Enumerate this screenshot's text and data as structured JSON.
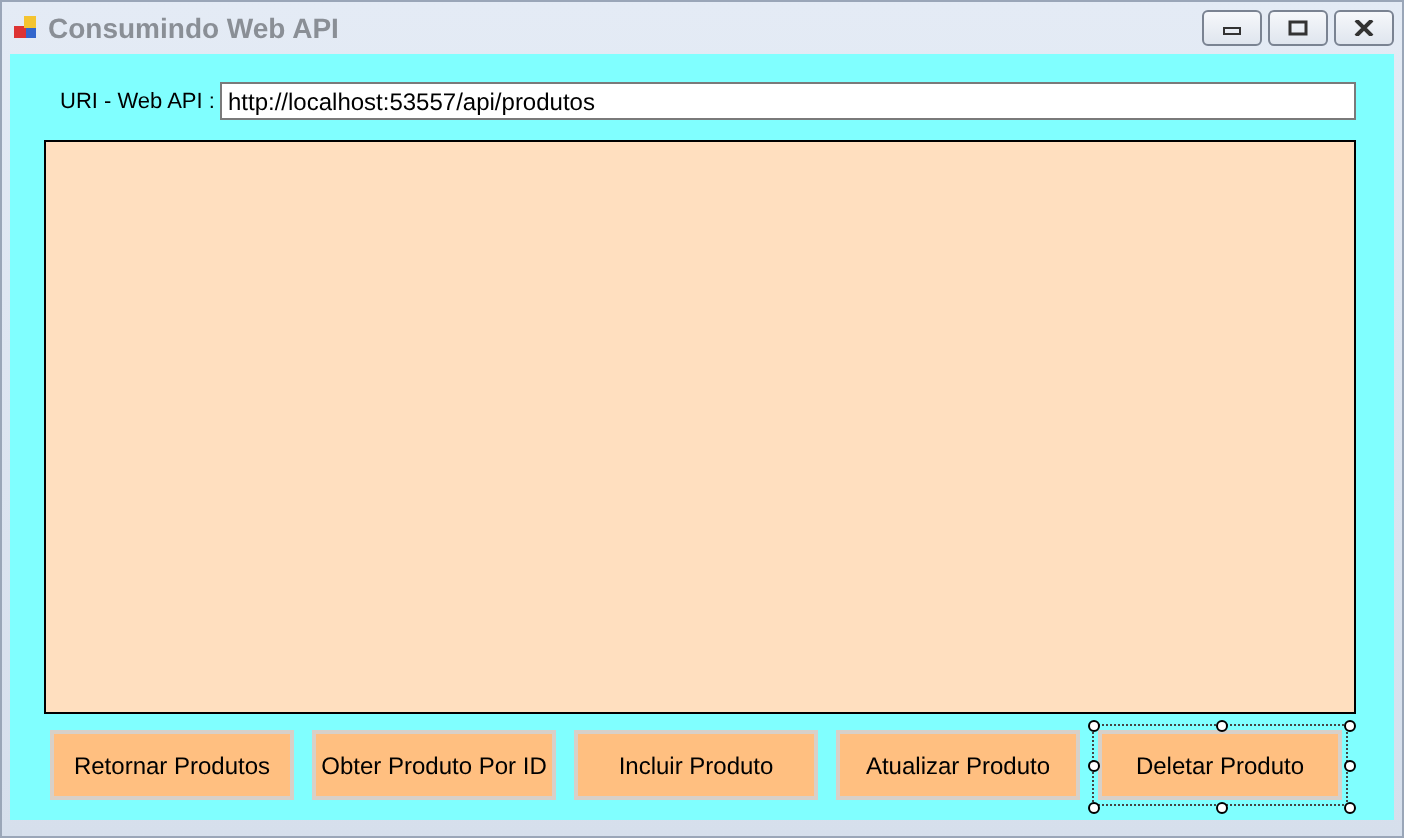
{
  "window": {
    "title": "Consumindo Web API"
  },
  "uri": {
    "label": "URI - Web API :",
    "value": "http://localhost:53557/api/produtos"
  },
  "buttons": [
    {
      "label": "Retornar Produtos",
      "selected": false
    },
    {
      "label": "Obter Produto Por ID",
      "selected": false
    },
    {
      "label": "Incluir Produto",
      "selected": false
    },
    {
      "label": "Atualizar Produto",
      "selected": false
    },
    {
      "label": "Deletar Produto",
      "selected": true
    }
  ]
}
